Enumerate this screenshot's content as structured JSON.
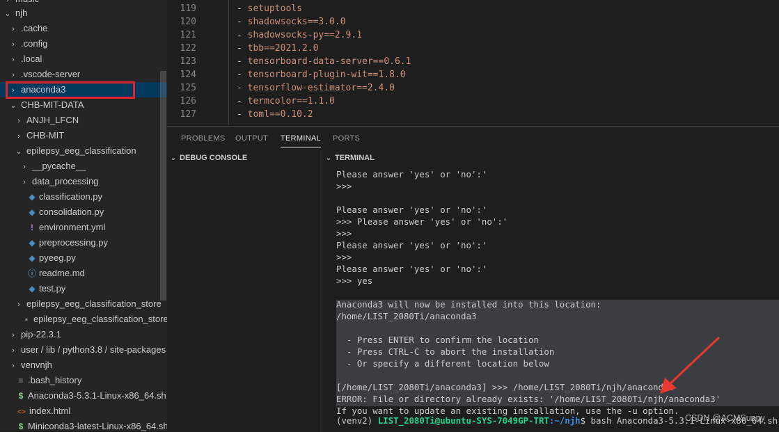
{
  "explorer": {
    "top_partial": "music",
    "items": [
      {
        "label": "njh",
        "chev": "⌄",
        "icon": "",
        "indent": 0
      },
      {
        "label": ".cache",
        "chev": "›",
        "icon": "",
        "indent": 1
      },
      {
        "label": ".config",
        "chev": "›",
        "icon": "",
        "indent": 1
      },
      {
        "label": ".local",
        "chev": "›",
        "icon": "",
        "indent": 1
      },
      {
        "label": ".vscode-server",
        "chev": "›",
        "icon": "",
        "indent": 1
      },
      {
        "label": "anaconda3",
        "chev": "›",
        "icon": "",
        "indent": 1
      },
      {
        "label": "CHB-MIT-DATA",
        "chev": "⌄",
        "icon": "",
        "indent": 1
      },
      {
        "label": "ANJH_LFCN",
        "chev": "›",
        "icon": "",
        "indent": 2
      },
      {
        "label": "CHB-MIT",
        "chev": "›",
        "icon": "",
        "indent": 2
      },
      {
        "label": "epilepsy_eeg_classification",
        "chev": "⌄",
        "icon": "",
        "indent": 2
      },
      {
        "label": "__pycache__",
        "chev": "›",
        "icon": "",
        "indent": 3
      },
      {
        "label": "data_processing",
        "chev": "›",
        "icon": "",
        "indent": 3
      },
      {
        "label": "classification.py",
        "chev": "",
        "icon": "python-file-icon",
        "indent": 3
      },
      {
        "label": "consolidation.py",
        "chev": "",
        "icon": "python-file-icon",
        "indent": 3
      },
      {
        "label": "environment.yml",
        "chev": "",
        "icon": "yaml-file-icon",
        "indent": 3
      },
      {
        "label": "preprocessing.py",
        "chev": "",
        "icon": "python-file-icon",
        "indent": 3
      },
      {
        "label": "pyeeg.py",
        "chev": "",
        "icon": "python-file-icon",
        "indent": 3
      },
      {
        "label": "readme.md",
        "chev": "",
        "icon": "info-file-icon",
        "indent": 3
      },
      {
        "label": "test.py",
        "chev": "",
        "icon": "python-file-icon",
        "indent": 3
      },
      {
        "label": "epilepsy_eeg_classification_store",
        "chev": "›",
        "icon": "",
        "indent": 2
      },
      {
        "label": "epilepsy_eeg_classification_store....",
        "chev": "",
        "icon": "generic-file-icon",
        "indent": 2
      },
      {
        "label": "pip-22.3.1",
        "chev": "›",
        "icon": "",
        "indent": 1
      },
      {
        "label": "user / lib / python3.8 / site-packages",
        "chev": "›",
        "icon": "",
        "indent": 1
      },
      {
        "label": "venvnjh",
        "chev": "›",
        "icon": "",
        "indent": 1
      },
      {
        "label": ".bash_history",
        "chev": "",
        "icon": "list-file-icon",
        "indent": 1
      },
      {
        "label": "Anaconda3-5.3.1-Linux-x86_64.sh",
        "chev": "",
        "icon": "shell-file-icon",
        "indent": 1
      },
      {
        "label": "index.html",
        "chev": "",
        "icon": "html-file-icon",
        "indent": 1
      },
      {
        "label": "Miniconda3-latest-Linux-x86_64.sh",
        "chev": "",
        "icon": "shell-file-icon",
        "indent": 1
      }
    ],
    "icon_glyphs": {
      "python-file-icon": "◆",
      "yaml-file-icon": "!",
      "info-file-icon": "ⓘ",
      "generic-file-icon": "▪",
      "list-file-icon": "≡",
      "shell-file-icon": "$",
      "html-file-icon": "<>"
    }
  },
  "editor": {
    "lines": [
      {
        "num": "119",
        "text": "setuptools"
      },
      {
        "num": "120",
        "text": "shadowsocks==3.0.0"
      },
      {
        "num": "121",
        "text": "shadowsocks-py==2.9.1"
      },
      {
        "num": "122",
        "text": "tbb==2021.2.0"
      },
      {
        "num": "123",
        "text": "tensorboard-data-server==0.6.1"
      },
      {
        "num": "124",
        "text": "tensorboard-plugin-wit==1.8.0"
      },
      {
        "num": "125",
        "text": "tensorflow-estimator==2.4.0"
      },
      {
        "num": "126",
        "text": "termcolor==1.1.0"
      },
      {
        "num": "127",
        "text": "toml==0.10.2"
      }
    ]
  },
  "panel": {
    "tabs": [
      "PROBLEMS",
      "OUTPUT",
      "TERMINAL",
      "PORTS"
    ],
    "active_tab": "TERMINAL",
    "debug_console_header": "DEBUG CONSOLE",
    "terminal_header": "TERMINAL"
  },
  "terminal": {
    "lines": [
      "Please answer 'yes' or 'no':'",
      ">>>",
      "",
      "Please answer 'yes' or 'no':'",
      ">>> Please answer 'yes' or 'no':'",
      ">>>",
      "Please answer 'yes' or 'no':'",
      ">>>",
      "Please answer 'yes' or 'no':'",
      ">>> yes",
      "",
      "Anaconda3 will now be installed into this location:",
      "/home/LIST_2080Ti/anaconda3",
      "",
      "  - Press ENTER to confirm the location",
      "  - Press CTRL-C to abort the installation",
      "  - Or specify a different location below",
      "",
      "[/home/LIST_2080Ti/anaconda3] >>> /home/LIST_2080Ti/njh/anaconda3",
      "ERROR: File or directory already exists: '/home/LIST_2080Ti/njh/anaconda3'",
      "If you want to update an existing installation, use the -u option."
    ],
    "prompt": {
      "env": "(venv2) ",
      "user_host": "LIST_2080Ti@ubuntu-SYS-7049GP-TRT",
      "path": ":~/njh",
      "command": "$ bash Anaconda3-5.3.1-Linux-x86_64.sh"
    }
  },
  "watermark": "CSDN @ACMSunny",
  "colors": {
    "highlight": "#e0242f",
    "arrow": "#e8382f",
    "selection": "#3a3d41"
  }
}
